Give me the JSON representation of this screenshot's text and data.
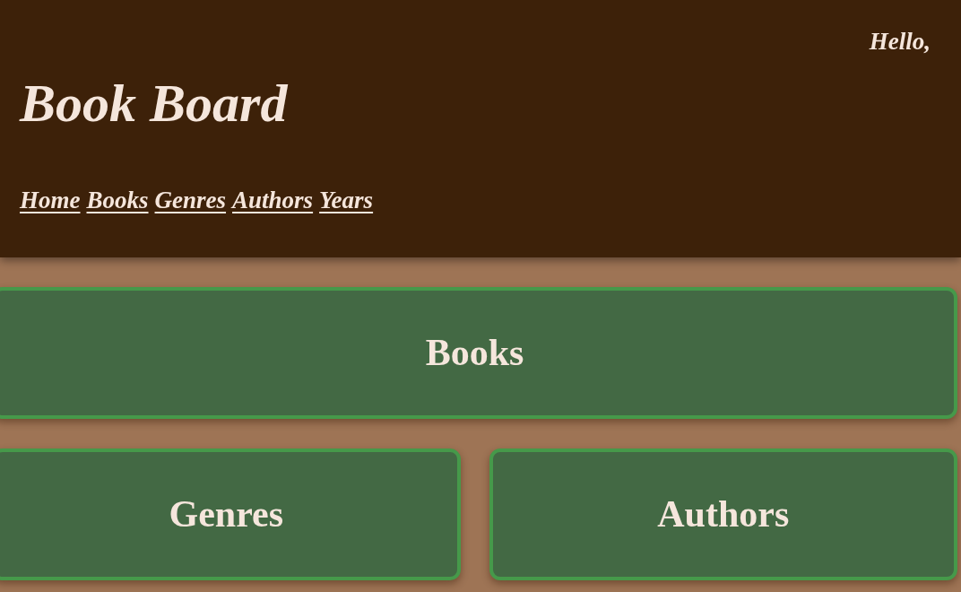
{
  "header": {
    "greeting": "Hello,",
    "title": "Book Board",
    "nav_links": [
      "Home",
      "Books",
      "Genres",
      "Authors",
      "Years"
    ]
  },
  "cards": [
    {
      "label": "Books"
    },
    {
      "label": "Genres"
    },
    {
      "label": "Authors"
    }
  ]
}
